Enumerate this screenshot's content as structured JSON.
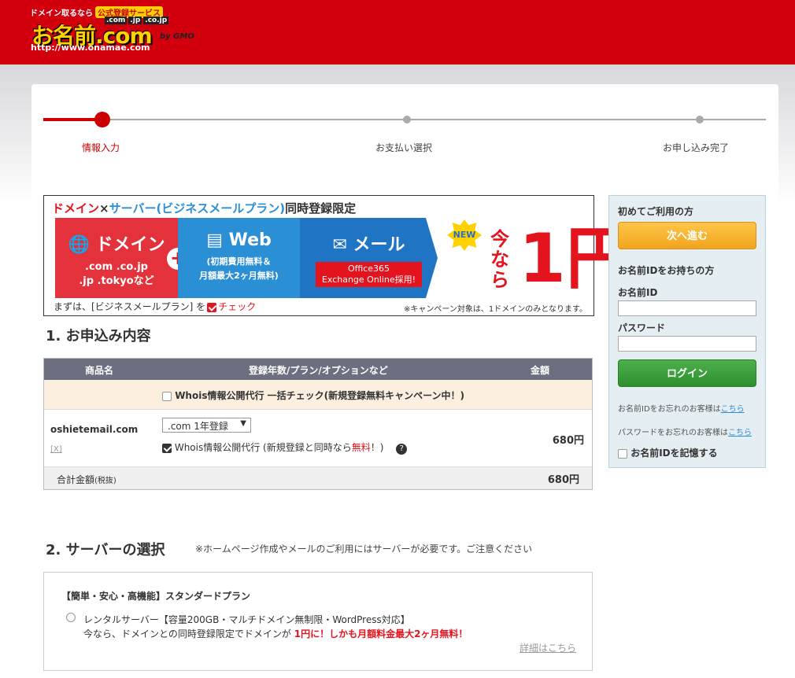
{
  "header": {
    "tagline": "ドメイン取るなら",
    "tagline_badge": "公式登録サービス",
    "tlds": [
      ".com",
      ".jp",
      ".co.jp"
    ],
    "logo_text": "お名前.com",
    "by": "by GMO",
    "url": "http://www.onamae.com"
  },
  "steps": [
    {
      "label": "情報入力",
      "active": true
    },
    {
      "label": "お支払い選択",
      "active": false
    },
    {
      "label": "お申し込み完了",
      "active": false
    }
  ],
  "banner": {
    "title_domain": "ドメイン",
    "title_x": "×",
    "title_server": "サーバー(ビジネスメールプラン)",
    "title_rest": "同時登録限定",
    "domain_label": "ドメイン",
    "domain_tlds_1": ".com .co.jp",
    "domain_tlds_2": ".jp .tokyoなど",
    "web_label": "Web",
    "web_sub_1": "(初期費用無料＆",
    "web_sub_2": "月額最大2ヶ月無料)",
    "mail_label": "メール",
    "mail_office_1": "Office365",
    "mail_office_2": "Exchange Online採用!",
    "new_badge": "NEW",
    "now": "今なら",
    "price": "1円",
    "footer_pre": "まずは、[ビジネスメールプラン] を",
    "footer_check": "チェック",
    "footer_note": "※キャンペーン対象は、1ドメインのみとなります。",
    "colors": {
      "domain": "#e4323c",
      "web": "#2b8fd6",
      "mail": "#1f74c4",
      "accent": "#e4141e"
    }
  },
  "section1": {
    "title": "1. お申込み内容",
    "col_product": "商品名",
    "col_plan": "登録年数/プラン/オプションなど",
    "col_price": "金額",
    "campaign_label": "Whois情報公開代行 一括チェック(新規登録無料キャンペーン中！)",
    "domain": "oshietemail.com",
    "remove": "[X]",
    "select_value": ".com 1年登録",
    "whois_pre": "Whois情報公開代行 (新規登録と同時なら",
    "whois_free": "無料",
    "whois_post": "！)",
    "row_price": "680円",
    "total_label": "合計金額",
    "total_tax": "(税抜)",
    "total_price": "680円"
  },
  "section2": {
    "title": "2. サーバーの選択",
    "note": "※ホームページ作成やメールのご利用にはサーバーが必要です。ご注意ください",
    "plan_title": "【簡単・安心・高機能】スタンダードプラン",
    "plan_desc": "レンタルサーバー【容量200GB・マルチドメイン無制限・WordPress対応】",
    "plan_promo_pre": "今なら、ドメインとの同時登録限定でドメインが",
    "plan_promo_red": "1円に！しかも月額料金最大2ヶ月無料！",
    "detail_link": "詳細はこちら"
  },
  "sidebar": {
    "first_time": "初めてご利用の方",
    "next_button": "次へ進む",
    "have_id": "お名前IDをお持ちの方",
    "id_label": "お名前ID",
    "password_label": "パスワード",
    "login_button": "ログイン",
    "forgot_id_pre": "お名前IDをお忘れのお客様は",
    "forgot_id_link": "こちら",
    "forgot_pw_pre": "パスワードをお忘れのお客様は",
    "forgot_pw_link": "こちら",
    "remember": "お名前IDを記憶する"
  }
}
